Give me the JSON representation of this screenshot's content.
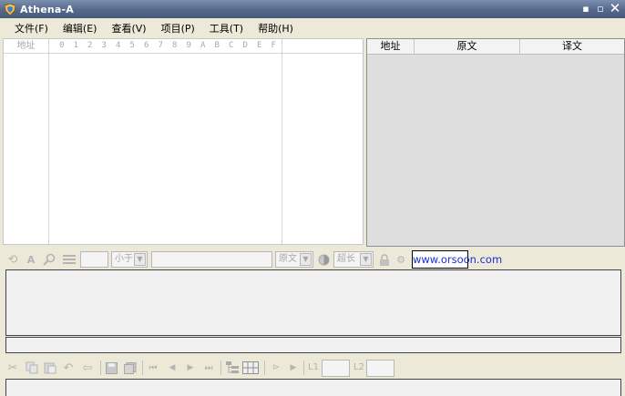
{
  "window": {
    "title": "Athena-A",
    "minimize": "▪",
    "restore": "▫",
    "close": "✕"
  },
  "menu": [
    "文件(F)",
    "编辑(E)",
    "查看(V)",
    "项目(P)",
    "工具(T)",
    "帮助(H)"
  ],
  "hex_view": {
    "address_header": "地址",
    "columns": [
      "0",
      "1",
      "2",
      "3",
      "4",
      "5",
      "6",
      "7",
      "8",
      "9",
      "A",
      "B",
      "C",
      "D",
      "E",
      "F"
    ]
  },
  "translation_table": {
    "columns": [
      "地址",
      "原文",
      "译文"
    ]
  },
  "toolbar1": {
    "compare_select": "小于",
    "source_select": "原文",
    "overlength_label": "超长"
  },
  "watermark": "www.orsoon.com",
  "toolbar2": {
    "label_l1": "L1",
    "label_l2": "L2"
  }
}
